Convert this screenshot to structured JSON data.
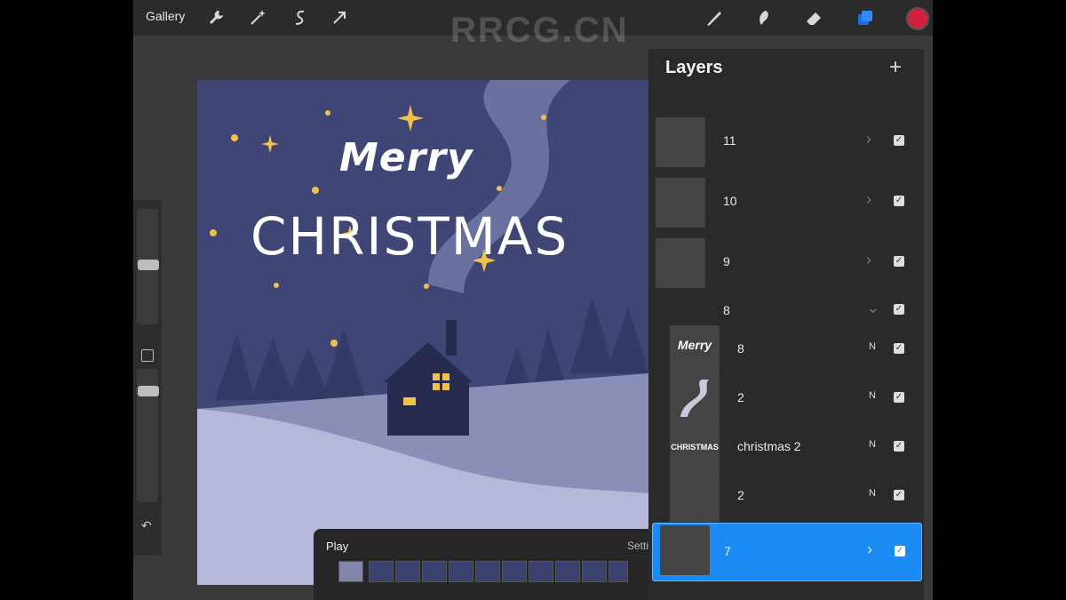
{
  "topbar": {
    "gallery_label": "Gallery",
    "tools_left": [
      "wrench-icon",
      "magic-wand-icon",
      "selection-icon",
      "transform-icon"
    ],
    "tools_right": [
      "brush-icon",
      "smudge-icon",
      "eraser-icon",
      "layers-icon"
    ],
    "color_hex": "#d1203b",
    "watermark": "RRCG.CN"
  },
  "canvas": {
    "title_line1": "Merry",
    "title_line2": "CHRISTMAS",
    "sky_color": "#3f4675",
    "snow_color": "#a9acd0",
    "star_color": "#f0c14b"
  },
  "layers": {
    "title": "Layers",
    "add_label": "+",
    "rows": [
      {
        "name": "11",
        "mode": "",
        "type": "group-frame",
        "checked": true
      },
      {
        "name": "10",
        "mode": "",
        "type": "group-frame",
        "checked": true
      },
      {
        "name": "9",
        "mode": "",
        "type": "group-frame",
        "checked": true
      },
      {
        "name": "8",
        "mode": "",
        "type": "group-open",
        "checked": true
      },
      {
        "name": "8",
        "mode": "N",
        "type": "layer",
        "thumb_text": "Merry",
        "checked": true
      },
      {
        "name": "2",
        "mode": "N",
        "type": "layer",
        "checked": true
      },
      {
        "name": "christmas 2",
        "mode": "N",
        "type": "layer",
        "thumb_text": "CHRISTMAS",
        "checked": true
      },
      {
        "name": "2",
        "mode": "N",
        "type": "layer",
        "checked": true
      },
      {
        "name": "7",
        "mode": "",
        "type": "group-frame",
        "checked": true,
        "selected": true
      }
    ]
  },
  "animation": {
    "play_label": "Play",
    "settings_label": "Settings"
  }
}
